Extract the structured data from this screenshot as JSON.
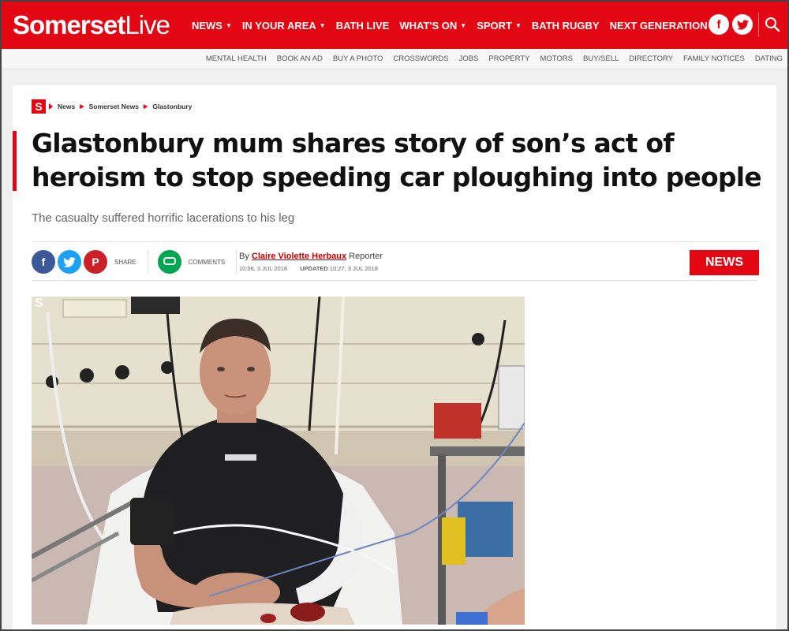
{
  "brand": {
    "name_part1": "Somerset",
    "name_part2": "Live",
    "color": "#e30613"
  },
  "main_nav": [
    {
      "label": "NEWS",
      "has_dropdown": true
    },
    {
      "label": "IN YOUR AREA",
      "has_dropdown": true
    },
    {
      "label": "BATH LIVE",
      "has_dropdown": false
    },
    {
      "label": "WHAT'S ON",
      "has_dropdown": true
    },
    {
      "label": "SPORT",
      "has_dropdown": true
    },
    {
      "label": "BATH RUGBY",
      "has_dropdown": false
    },
    {
      "label": "NEXT GENERATION",
      "has_dropdown": false
    }
  ],
  "top_icons": [
    "facebook-icon",
    "twitter-icon",
    "search-icon"
  ],
  "sub_nav": [
    "MENTAL HEALTH",
    "BOOK AN AD",
    "BUY A PHOTO",
    "CROSSWORDS",
    "JOBS",
    "PROPERTY",
    "MOTORS",
    "BUY/SELL",
    "DIRECTORY",
    "FAMILY NOTICES",
    "DATING"
  ],
  "breadcrumb": {
    "badge": "S",
    "items": [
      "News",
      "Somerset News",
      "Glastonbury"
    ]
  },
  "article": {
    "headline": "Glastonbury mum shares story of son’s act of heroism to stop speeding car ploughing into people",
    "standfirst": "The casualty suffered horrific lacerations to his leg",
    "share_label": "SHARE",
    "comments_label": "COMMENTS",
    "by_prefix": "By",
    "author": "Claire Violette Herbaux",
    "author_role": "Reporter",
    "published": "10:06, 3 JUL 2018",
    "updated_label": "UPDATED",
    "updated": "10:27, 3 JUL 2018",
    "category_tag": "NEWS",
    "photo_badge": "S"
  }
}
